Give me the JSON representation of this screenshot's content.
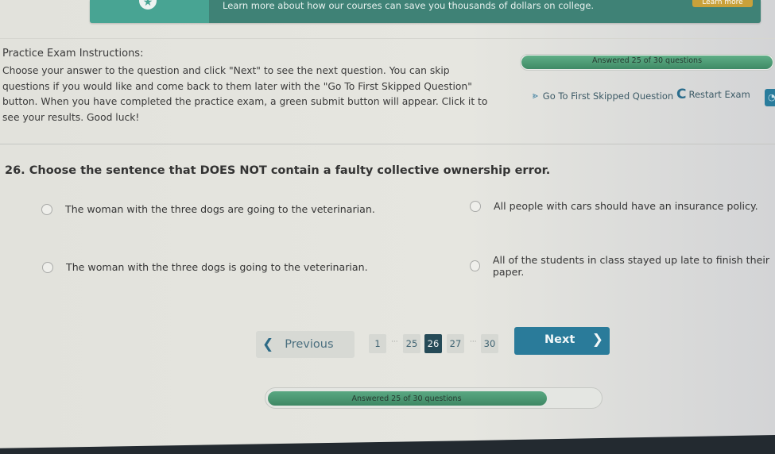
{
  "banner": {
    "text": "Learn more about how our courses can save you thousands of dollars on college.",
    "button_label": "Learn more",
    "icon": "star-badge-icon"
  },
  "instructions": {
    "title": "Practice Exam Instructions:",
    "body": "Choose your answer to the question and click \"Next\" to see the next question. You can skip questions if you would like and come back to them later with the \"Go To First Skipped Question\" button. When you have completed the practice exam, a green submit button will appear. Click it to see your results. Good luck!"
  },
  "progress": {
    "answered": 25,
    "total": 30,
    "fraction": 0.833,
    "label": "Answered 25 of 30 questions"
  },
  "actions": {
    "skip_label": "Go To First Skipped Question",
    "skip_icon": "double-chevron-right-icon",
    "restart_label": "Restart Exam",
    "restart_icon": "restart-icon"
  },
  "question": {
    "number": "26.",
    "text": "Choose the sentence that DOES NOT contain a faulty collective ownership error.",
    "options": [
      {
        "label": "The woman with the three dogs are going to the veterinarian.",
        "selected": false
      },
      {
        "label": "All people with cars should have an insurance policy.",
        "selected": false
      },
      {
        "label": "The woman with the three dogs is going to the veterinarian.",
        "selected": false
      },
      {
        "label": "All of the students in class stayed up late to finish their paper.",
        "selected": false
      }
    ]
  },
  "navigation": {
    "previous_label": "Previous",
    "next_label": "Next",
    "pages": [
      "1",
      "25",
      "26",
      "27",
      "30"
    ],
    "ellipsis": "···",
    "current_page": "26"
  }
}
